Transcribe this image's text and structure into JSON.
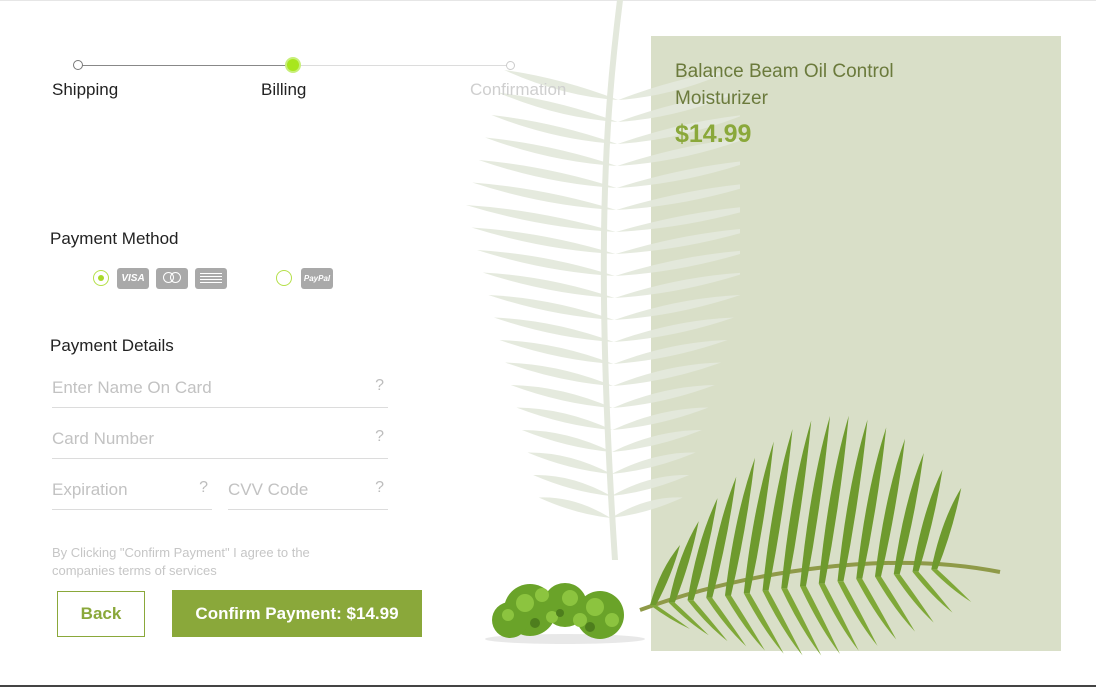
{
  "stepper": {
    "steps": [
      {
        "label": "Shipping",
        "state": "done"
      },
      {
        "label": "Billing",
        "state": "active"
      },
      {
        "label": "Confirmation",
        "state": "upcoming"
      }
    ]
  },
  "payment_method": {
    "heading": "Payment Method",
    "options": [
      {
        "name": "card",
        "selected": true,
        "logos": [
          "VISA",
          "mastercard-icon",
          "amex-icon"
        ]
      },
      {
        "name": "paypal",
        "selected": false,
        "logos": [
          "PayPal"
        ]
      }
    ],
    "visa_text": "VISA",
    "paypal_text": "PayPal"
  },
  "payment_details": {
    "heading": "Payment Details",
    "name_placeholder": "Enter Name On Card",
    "card_placeholder": "Card Number",
    "expiration_placeholder": "Expiration",
    "cvv_placeholder": "CVV Code",
    "help_mark": "?"
  },
  "terms": "By Clicking \"Confirm Payment\" I agree to the companies terms of services",
  "buttons": {
    "back": "Back",
    "confirm": "Confirm Payment: $14.99"
  },
  "product": {
    "name": "Balance Beam Oil Control Moisturizer",
    "price": "$14.99"
  },
  "colors": {
    "accent": "#8aa83a",
    "active_step": "#a8e61d",
    "panel": "#d9dfc8"
  }
}
